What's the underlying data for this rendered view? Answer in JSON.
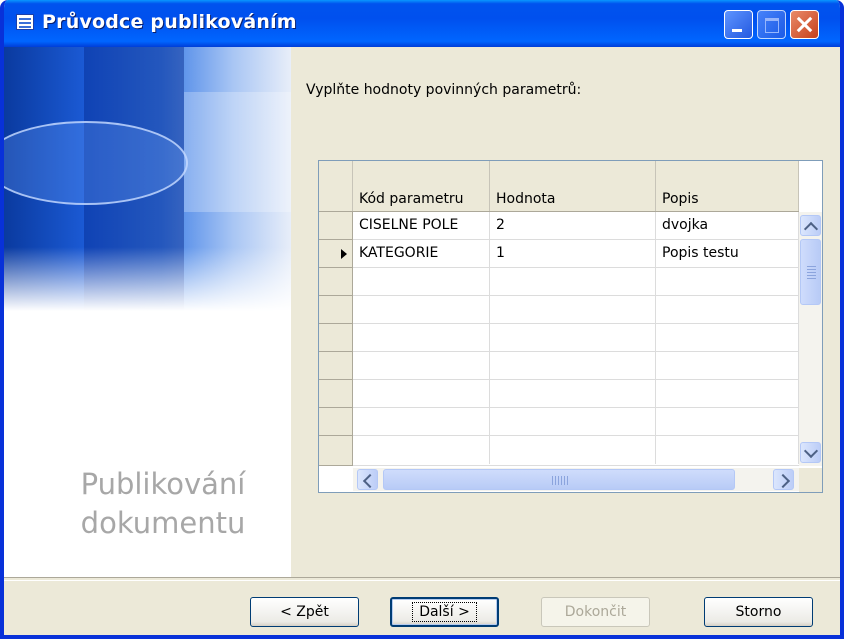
{
  "window": {
    "title": "Průvodce publikováním"
  },
  "left_panel": {
    "caption_line1": "Publikování",
    "caption_line2": "dokumentu"
  },
  "main": {
    "instruction": "Vyplňte hodnoty povinných parametrů:"
  },
  "grid": {
    "columns": [
      "Kód parametru",
      "Hodnota",
      "Popis"
    ],
    "rows": [
      {
        "code": "CISELNE POLE",
        "value": "2",
        "desc": "dvojka"
      },
      {
        "code": "KATEGORIE",
        "value": "1",
        "desc": "Popis testu"
      }
    ],
    "current_row_index": 1,
    "empty_rows": 7
  },
  "buttons": {
    "back": "< Zpět",
    "next": "Další >",
    "finish": "Dokončit",
    "cancel": "Storno"
  },
  "colors": {
    "title_bar": "#0053ee",
    "dialog_bg": "#ece9d8",
    "caption_text": "#a7a7a7"
  }
}
